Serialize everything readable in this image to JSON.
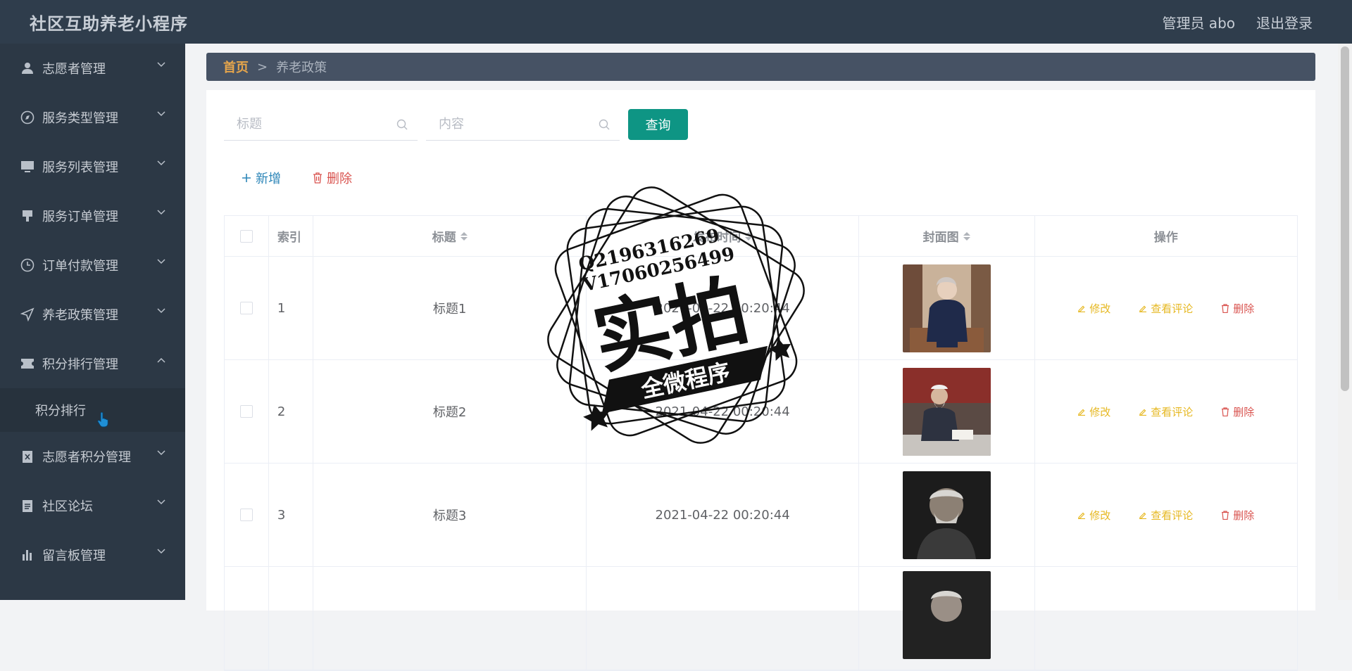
{
  "header": {
    "app_title": "社区互助养老小程序",
    "admin_label": "管理员 abo",
    "logout_label": "退出登录"
  },
  "sidebar": {
    "items": [
      {
        "label": "志愿者管理",
        "icon": "user-icon"
      },
      {
        "label": "服务类型管理",
        "icon": "compass-icon"
      },
      {
        "label": "服务列表管理",
        "icon": "monitor-icon"
      },
      {
        "label": "服务订单管理",
        "icon": "stamp-icon"
      },
      {
        "label": "订单付款管理",
        "icon": "clock-icon"
      },
      {
        "label": "养老政策管理",
        "icon": "send-icon"
      },
      {
        "label": "积分排行管理",
        "icon": "ticket-icon",
        "expanded": true
      },
      {
        "label": "志愿者积分管理",
        "icon": "clipboard-icon"
      },
      {
        "label": "社区论坛",
        "icon": "notebook-icon"
      },
      {
        "label": "留言板管理",
        "icon": "bar-chart-icon"
      }
    ],
    "submenu": [
      {
        "label": "积分排行"
      }
    ]
  },
  "breadcrumb": {
    "home": "首页",
    "separator": ">",
    "current": "养老政策"
  },
  "search": {
    "title_placeholder": "标题",
    "content_placeholder": "内容",
    "query_label": "查询"
  },
  "actions": {
    "add_label": "新增",
    "delete_label": "删除"
  },
  "table": {
    "columns": [
      "索引",
      "标题",
      "发布时间",
      "封面图",
      "操作"
    ],
    "rows": [
      {
        "index": "1",
        "title": "标题1",
        "time": "2021-04-22 00:20:44"
      },
      {
        "index": "2",
        "title": "标题2",
        "time": "2021-04-22 00:20:44"
      },
      {
        "index": "3",
        "title": "标题3",
        "time": "2021-04-22 00:20:44"
      }
    ],
    "ops": {
      "edit": "修改",
      "review": "查看评论",
      "delete": "删除"
    }
  },
  "watermark": {
    "line1": "Q2196316269",
    "line2": "V17060256499",
    "main": "实拍",
    "banner": "全微程序"
  },
  "colors": {
    "topbar": "#2f3d4c",
    "sidebar": "#2c3845",
    "breadcrumb": "#465264",
    "accent_home": "#e7a64b",
    "query_button": "#0e9584",
    "add": "#2d86b8",
    "delete": "#d9534f",
    "edit": "#e6b822"
  }
}
